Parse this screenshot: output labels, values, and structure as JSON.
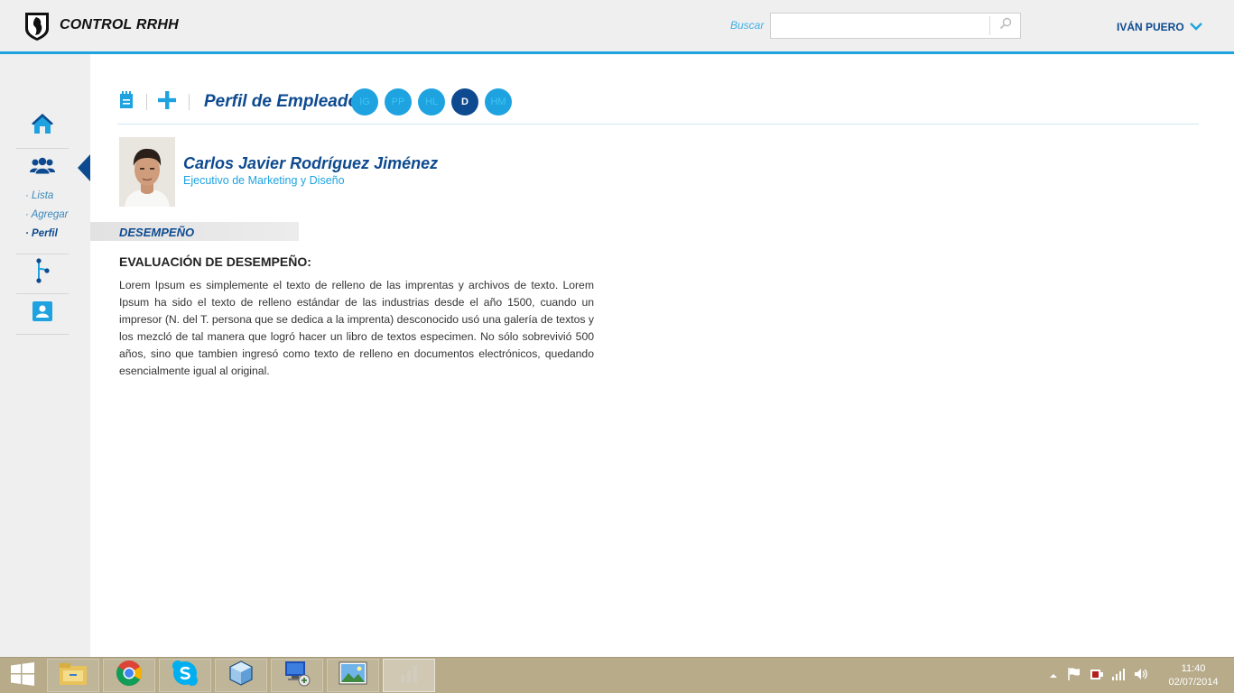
{
  "header": {
    "app_title": "CONTROL RRHH",
    "search_label": "Buscar",
    "search_value": "",
    "user_name": "IVÁN PUERO"
  },
  "sidebar": {
    "sub_items": [
      "· Lista",
      "· Agregar",
      "· Perfil"
    ],
    "active_sub_item": "· Perfil"
  },
  "toolbar": {
    "title": "Perfil de Empleado",
    "tabs": [
      "IG",
      "PP",
      "HL",
      "D",
      "HM"
    ],
    "active_tab": "D"
  },
  "employee": {
    "name": "Carlos Javier Rodríguez Jiménez",
    "role": "Ejecutivo de Marketing y Diseño"
  },
  "section": {
    "title": "DESEMPEÑO",
    "heading": "EVALUACIÓN DE DESEMPEÑO:",
    "body": "Lorem Ipsum es simplemente el texto de relleno de las imprentas y archivos de texto. Lorem Ipsum ha sido el texto de relleno estándar de las industrias desde el año 1500, cuando un impresor (N. del T. persona que se dedica a la imprenta) desconocido usó una galería de textos y los mezcló de tal manera que logró hacer un libro de textos especimen. No sólo sobrevivió 500 años, sino que tambien ingresó como texto de relleno en documentos electrónicos, quedando esencialmente igual al original."
  },
  "taskbar": {
    "apps": [
      "file-explorer-icon",
      "chrome-icon",
      "skype-icon",
      "virtualbox-icon",
      "remote-desktop-icon",
      "photo-viewer-icon",
      "app-icon"
    ],
    "time": "11:40",
    "date": "02/07/2014"
  },
  "colors": {
    "brand_dark": "#0d4a8f",
    "accent": "#1ea3e0",
    "taskbar": "#b7ab8a"
  }
}
